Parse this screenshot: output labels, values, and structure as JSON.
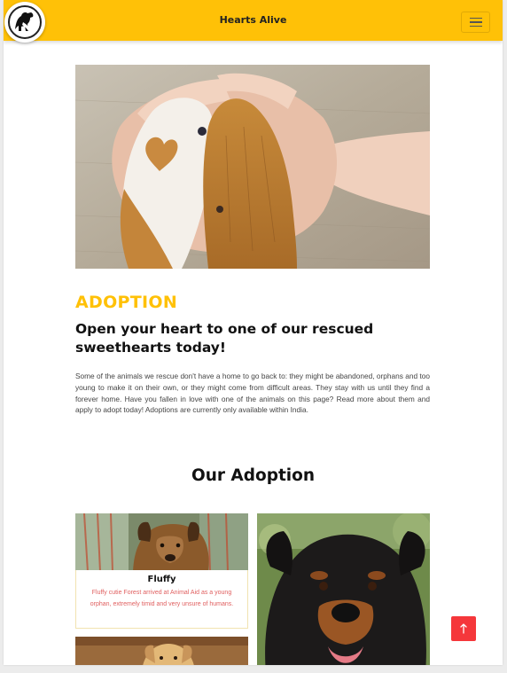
{
  "header": {
    "brand": "Hearts Alive",
    "logo_icon": "dog-silhouette-logo",
    "menu_icon": "hamburger-menu-icon",
    "bg_color": "#ffc107"
  },
  "hero": {
    "image": "dog-paws-in-human-hands"
  },
  "adoption": {
    "label": "ADOPTION",
    "headline": "Open your heart to one of our rescued sweethearts today!",
    "intro": "Some of the animals we rescue don't have a home to go back to: they might be abandoned, orphans and too young to make it on their own, or they might come from difficult areas. They stay with us until they find a forever home. Have you fallen in love with one of the animals on this page? Read more about them and apply to adopt today! Adoptions are currently only available within India.",
    "label_color": "#ffc107"
  },
  "gallery": {
    "title": "Our Adoption",
    "cards": [
      {
        "name": "Fluffy",
        "description": "Fluffy cutie Forest arrived at Animal Aid as a young orphan, extremely timid and very unsure of humans.",
        "image": "brown-puppy-photo"
      }
    ],
    "extra_images": [
      "golden-puppy-photo",
      "rottweiler-photo"
    ]
  },
  "back_to_top": {
    "icon": "arrow-up-icon",
    "color": "#f5373b"
  }
}
